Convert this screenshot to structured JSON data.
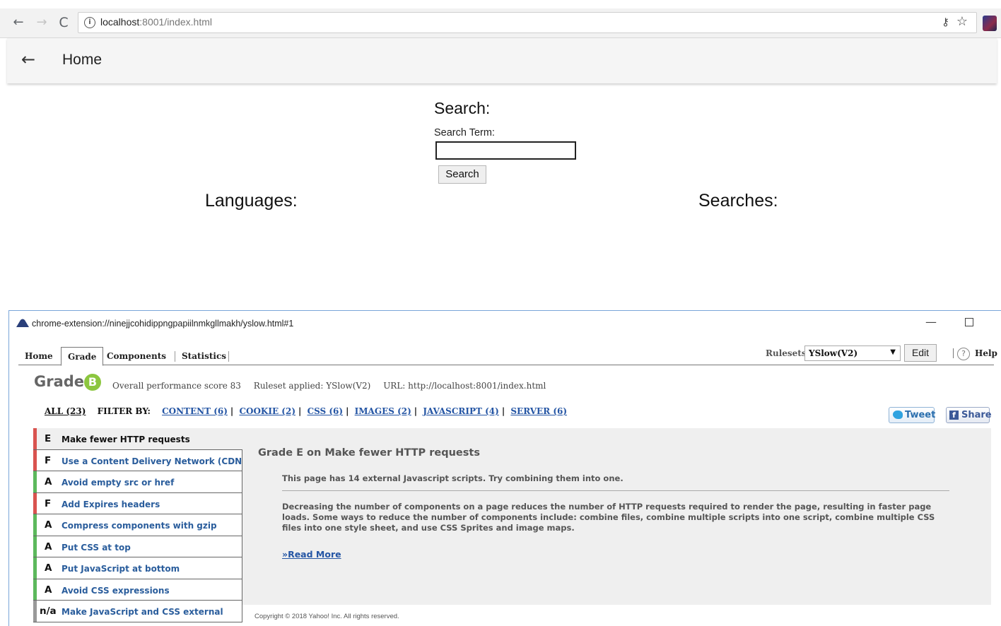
{
  "browser": {
    "url_host": "localhost",
    "url_rest": ":8001/index.html"
  },
  "app": {
    "title": "Home",
    "search_heading": "Search:",
    "search_label": "Search Term:",
    "search_value": "",
    "search_button": "Search",
    "languages_heading": "Languages:",
    "searches_heading": "Searches:"
  },
  "yslow": {
    "window_title": "chrome-extension://ninejjcohidippngpapiilnmkgllmakh/yslow.html#1",
    "tabs": [
      {
        "label": "Home"
      },
      {
        "label": "Grade"
      },
      {
        "label": "Components"
      },
      {
        "label": "Statistics"
      }
    ],
    "rulesets_label": "Rulesets",
    "rulesets_value": "YSlow(V2)",
    "edit_label": "Edit",
    "help_label": "Help",
    "grade_word": "Grade",
    "grade_letter": "B",
    "overall_score": "Overall performance score 83",
    "ruleset_applied": "Ruleset applied: YSlow(V2)",
    "url_info": "URL: http://localhost:8001/index.html",
    "filter": {
      "all": "ALL (23)",
      "by": "FILTER BY:",
      "items": [
        {
          "label": "CONTENT (6)"
        },
        {
          "label": "COOKIE (2)"
        },
        {
          "label": "CSS (6)"
        },
        {
          "label": "IMAGES (2)"
        },
        {
          "label": "JAVASCRIPT (4)"
        },
        {
          "label": "SERVER (6)"
        }
      ]
    },
    "tweet_label": "Tweet",
    "share_label": "Share",
    "rules": [
      {
        "grade": "E",
        "label": "Make fewer HTTP requests",
        "color": "#d9534f"
      },
      {
        "grade": "F",
        "label": "Use a Content Delivery Network (CDN)",
        "color": "#d9534f"
      },
      {
        "grade": "A",
        "label": "Avoid empty src or href",
        "color": "#5cb85c"
      },
      {
        "grade": "F",
        "label": "Add Expires headers",
        "color": "#d9534f"
      },
      {
        "grade": "A",
        "label": "Compress components with gzip",
        "color": "#5cb85c"
      },
      {
        "grade": "A",
        "label": "Put CSS at top",
        "color": "#5cb85c"
      },
      {
        "grade": "A",
        "label": "Put JavaScript at bottom",
        "color": "#5cb85c"
      },
      {
        "grade": "A",
        "label": "Avoid CSS expressions",
        "color": "#5cb85c"
      },
      {
        "grade": "n/a",
        "label": "Make JavaScript and CSS external",
        "color": "#999999"
      }
    ],
    "detail": {
      "title": "Grade E on Make fewer HTTP requests",
      "message": "This page has 14 external Javascript scripts. Try combining them into one.",
      "description": "Decreasing the number of components on a page reduces the number of HTTP requests required to render the page, resulting in faster page loads. Some ways to reduce the number of components include: combine files, combine multiple scripts into one script, combine multiple CSS files into one style sheet, and use CSS Sprites and image maps.",
      "read_more": "»Read More"
    },
    "copyright": "Copyright © 2018 Yahoo! Inc. All rights reserved."
  },
  "colors": {
    "grade_badge": "#8cc63f",
    "link": "#2455a4",
    "grade_fail": "#d9534f",
    "grade_pass": "#5cb85c"
  }
}
